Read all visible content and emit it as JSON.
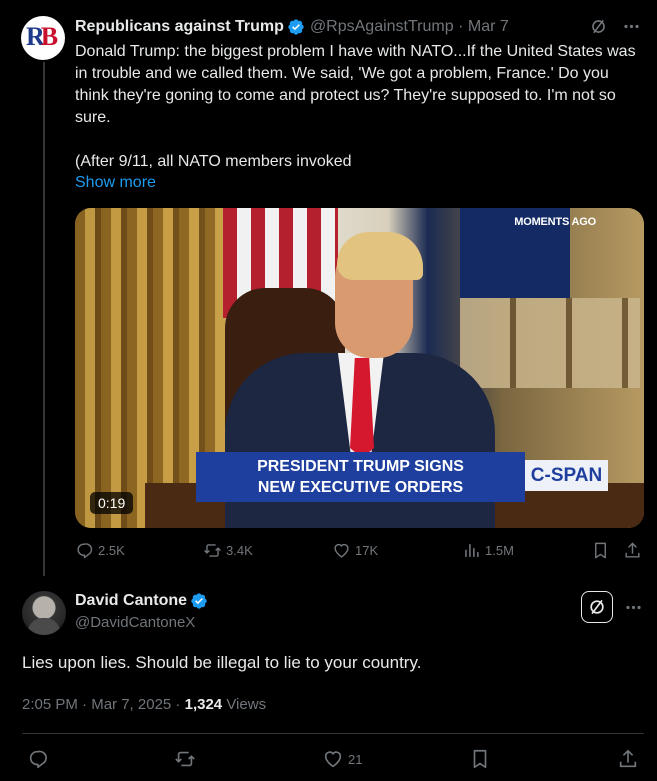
{
  "quoted": {
    "author_name": "Republicans against Trump",
    "author_handle": "@RpsAgainstTrump",
    "separator": "·",
    "date": "Mar 7",
    "avatar_text": "RB",
    "text": "Donald Trump: the biggest problem I have with NATO...If the United States was in trouble and we called them. We said, 'We got a problem, France.' Do you think they're goning to come and protect us? They're supposed to. I'm not so sure.\n\n(After 9/11, all NATO members invoked",
    "show_more": "Show more",
    "video": {
      "overlay_tag": "MOMENTS AGO",
      "chyron_line1": "PRESIDENT TRUMP SIGNS",
      "chyron_line2": "NEW EXECUTIVE ORDERS",
      "network": "C-SPAN",
      "duration": "0:19"
    },
    "stats": {
      "replies": "2.5K",
      "reposts": "3.4K",
      "likes": "17K",
      "views": "1.5M"
    }
  },
  "main": {
    "author_name": "David Cantone",
    "author_handle": "@DavidCantoneX",
    "text": "Lies upon lies. Should be illegal to lie to your country.",
    "time": "2:05 PM",
    "date": "Mar 7, 2025",
    "views_count": "1,324",
    "views_label": "Views",
    "stats": {
      "likes": "21"
    }
  },
  "colors": {
    "background": "#000000",
    "text": "#e7e9ea",
    "muted": "#71767b",
    "link": "#1d9bf0",
    "verified": "#1d9bf0"
  },
  "icons": [
    "grok-icon",
    "more-icon",
    "reply-icon",
    "repost-icon",
    "like-icon",
    "views-icon",
    "bookmark-icon",
    "share-icon",
    "verified-badge-icon"
  ]
}
